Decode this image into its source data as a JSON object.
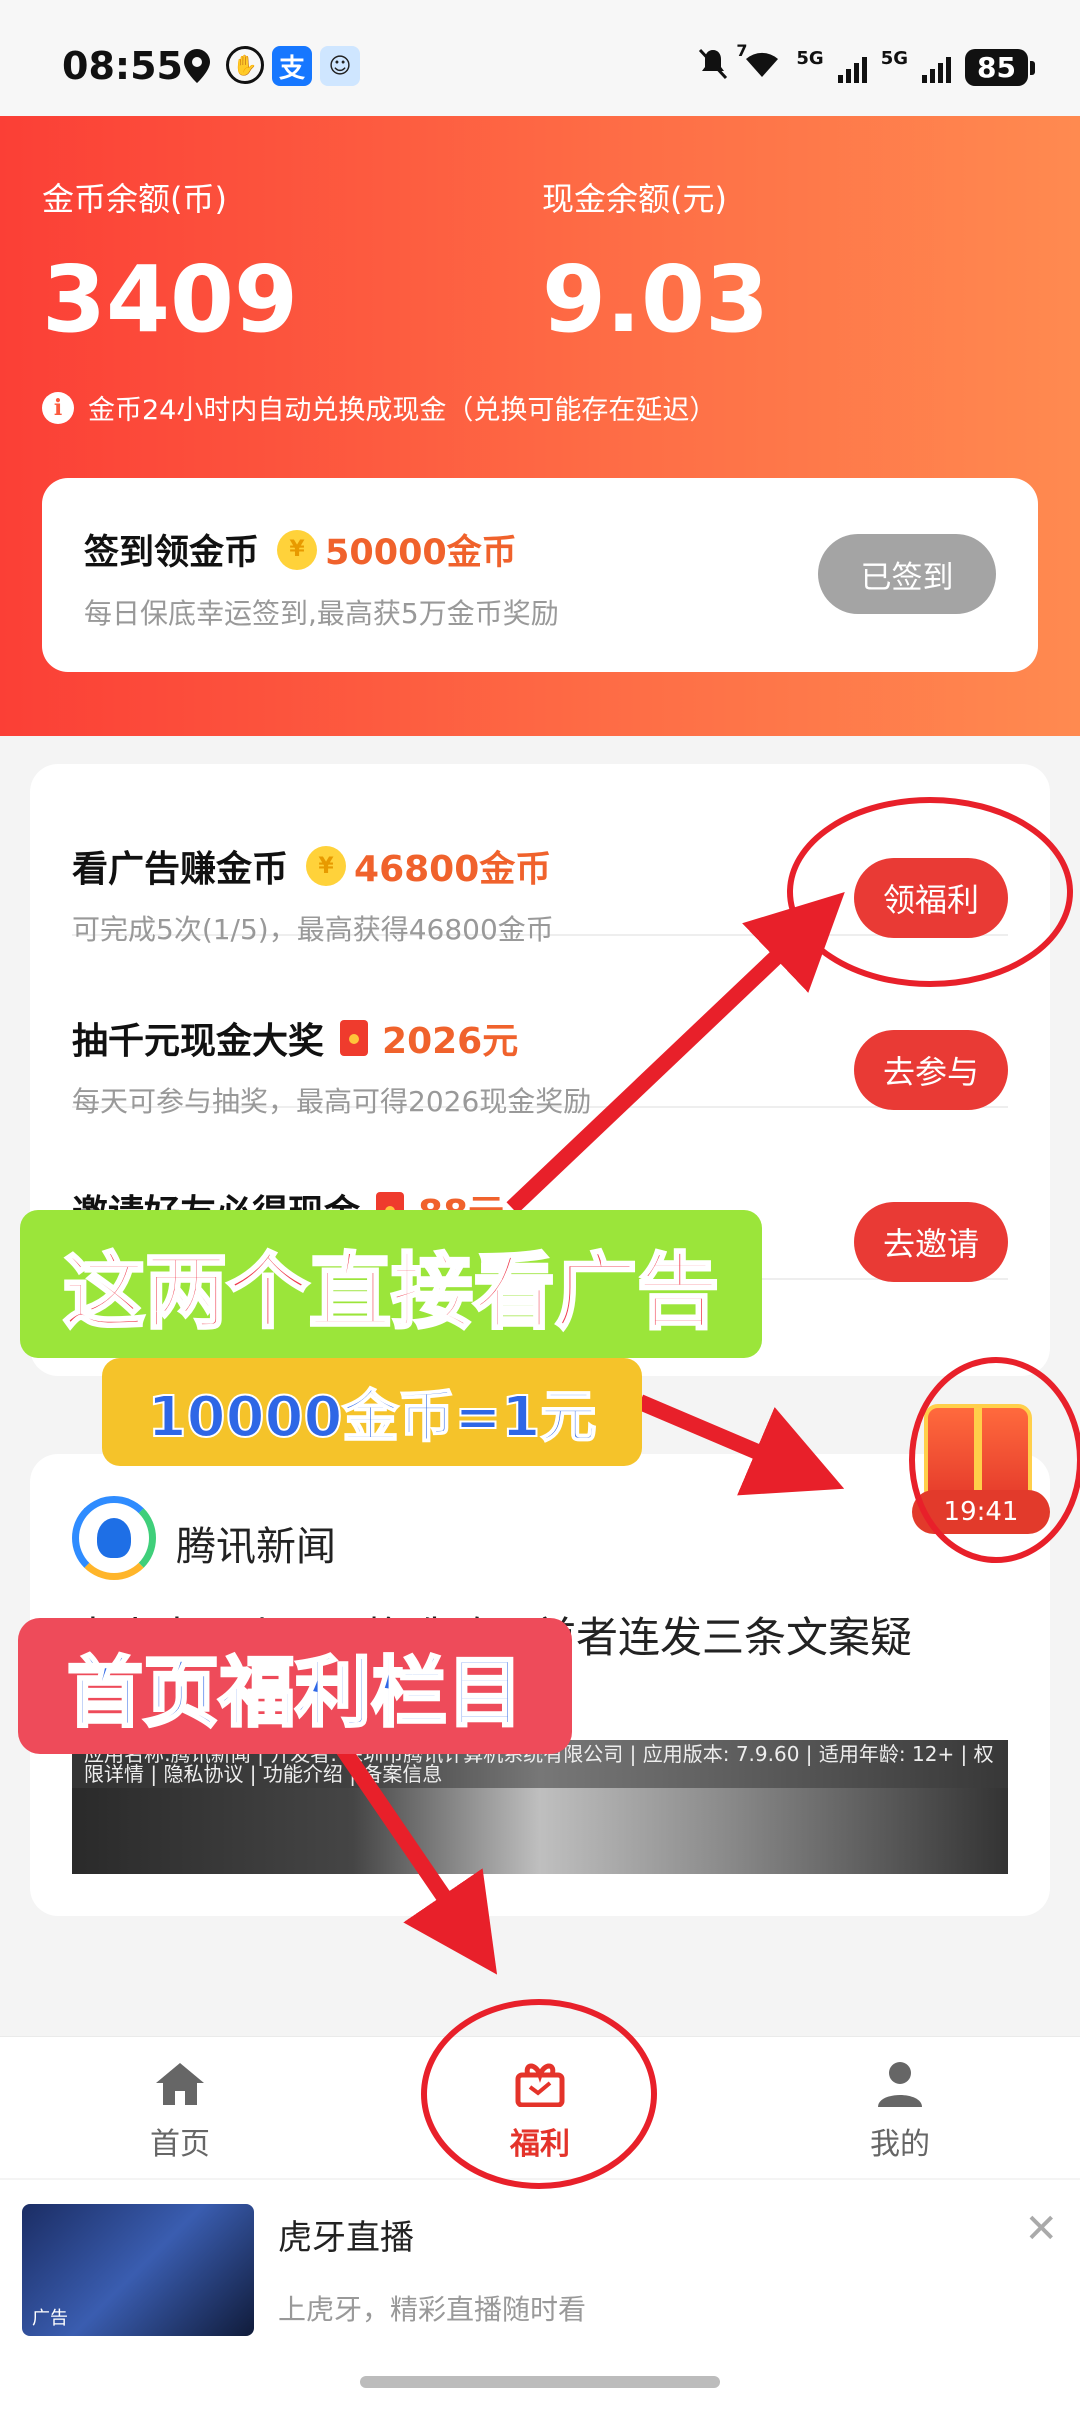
{
  "status_bar": {
    "time": "08:55",
    "battery": "85",
    "network_1": "5G",
    "network_2": "5G",
    "wifi_badge": "7",
    "alipay_glyph": "支",
    "icons": [
      "location-icon",
      "hand-icon",
      "alipay-icon",
      "app-icon",
      "mute-icon",
      "wifi-icon",
      "signal-icon",
      "battery-icon"
    ]
  },
  "balance": {
    "coin_label": "金币余额(币)",
    "coin_value": "3409",
    "cash_label": "现金余额(元)",
    "cash_value": "9.03",
    "notice": "金币24小时内自动兑换成现金（兑换可能存在延迟）"
  },
  "signin": {
    "title": "签到领金币",
    "reward": "50000金币",
    "subtitle": "每日保底幸运签到,最高获5万金币奖励",
    "button": "已签到"
  },
  "tasks": [
    {
      "title": "看广告赚金币",
      "reward": "46800金币",
      "reward_icon": "coin-icon",
      "subtitle": "可完成5次(1/5)，最高获得46800金币",
      "button": "领福利"
    },
    {
      "title": "抽千元现金大奖",
      "reward": "2026元",
      "reward_icon": "red-packet-icon",
      "subtitle": "每天可参与抽奖，最高可得2026现金奖励",
      "button": "去参与"
    },
    {
      "title": "邀请好友必得现金",
      "reward": "88元",
      "reward_icon": "red-packet-icon",
      "subtitle": "",
      "button": "去邀请"
    }
  ],
  "news": {
    "source": "腾讯新闻",
    "headline": "李小冉回张月回撸造致，前者连发三条文案疑",
    "meta": "应用名称:腾讯新闻 | 开发者: 深圳市腾讯计算机系统有限公司 | 应用版本: 7.9.60 | 适用年龄: 12+ | 权限详情 | 隐私协议 | 功能介绍 | 备案信息"
  },
  "floating_gift": {
    "timer": "19:41"
  },
  "bottom_nav": [
    {
      "label": "首页",
      "icon": "home-icon",
      "active": false
    },
    {
      "label": "福利",
      "icon": "gift-icon",
      "active": true
    },
    {
      "label": "我的",
      "icon": "person-icon",
      "active": false
    }
  ],
  "ad": {
    "title": "虎牙直播",
    "subtitle": "上虎牙，精彩直播随时看",
    "badge": "广告"
  },
  "annotations": {
    "callout_1": "这两个直接看广告",
    "callout_2": "10000金币=1元",
    "callout_3": "首页福利栏目",
    "color": "#e8202a"
  }
}
